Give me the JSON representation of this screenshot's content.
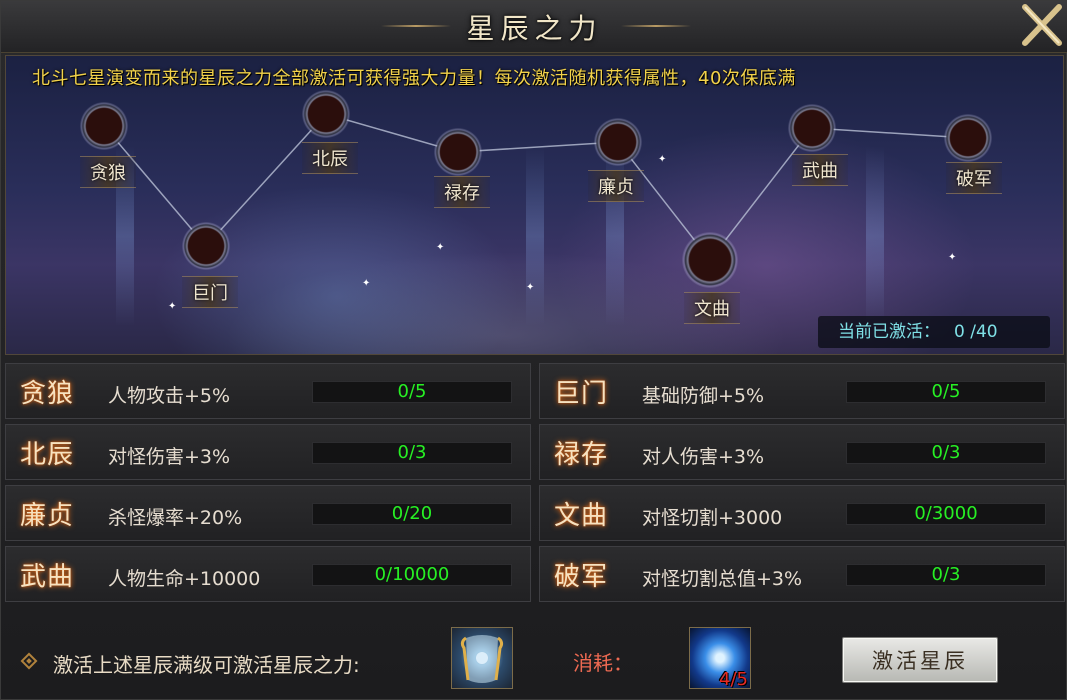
{
  "window": {
    "title": "星辰之力"
  },
  "description": "北斗七星演变而来的星辰之力全部激活可获得强大力量！每次激活随机获得属性，40次保底满",
  "stars": [
    {
      "label": "贪狼"
    },
    {
      "label": "巨门"
    },
    {
      "label": "北辰"
    },
    {
      "label": "禄存"
    },
    {
      "label": "廉贞"
    },
    {
      "label": "文曲"
    },
    {
      "label": "武曲"
    },
    {
      "label": "破军"
    }
  ],
  "activation": {
    "label": "当前已激活：",
    "value": "0 /40",
    "current": 0,
    "max": 40
  },
  "attributes": [
    {
      "name": "贪狼",
      "desc": "人物攻击+5%",
      "progress": "0/5",
      "current": 0,
      "max": 5
    },
    {
      "name": "巨门",
      "desc": "基础防御+5%",
      "progress": "0/5",
      "current": 0,
      "max": 5
    },
    {
      "name": "北辰",
      "desc": "对怪伤害+3%",
      "progress": "0/3",
      "current": 0,
      "max": 3
    },
    {
      "name": "禄存",
      "desc": "对人伤害+3%",
      "progress": "0/3",
      "current": 0,
      "max": 3
    },
    {
      "name": "廉贞",
      "desc": "杀怪爆率+20%",
      "progress": "0/20",
      "current": 0,
      "max": 20
    },
    {
      "name": "文曲",
      "desc": "对怪切割+3000",
      "progress": "0/3000",
      "current": 0,
      "max": 3000
    },
    {
      "name": "武曲",
      "desc": "人物生命+10000",
      "progress": "0/10000",
      "current": 0,
      "max": 10000
    },
    {
      "name": "破军",
      "desc": "对怪切割总值+3%",
      "progress": "0/3",
      "current": 0,
      "max": 3
    }
  ],
  "bottom": {
    "hint": "激活上述星辰满级可激活星辰之力:",
    "cost_label": "消耗：",
    "cost_item_count": "4/5",
    "activate_button": "激活星辰"
  },
  "icons": {
    "close": "close-icon",
    "reward": "scroll-item-icon",
    "cost": "blue-orb-icon",
    "hint": "diamond-bullet-icon"
  },
  "colors": {
    "title": "#f1e6c8",
    "description": "#f2d24a",
    "progress_text": "#27f024",
    "count_text": "#7fe0e6",
    "cost_text": "#ee6a52",
    "item_count": "#e62a22"
  }
}
